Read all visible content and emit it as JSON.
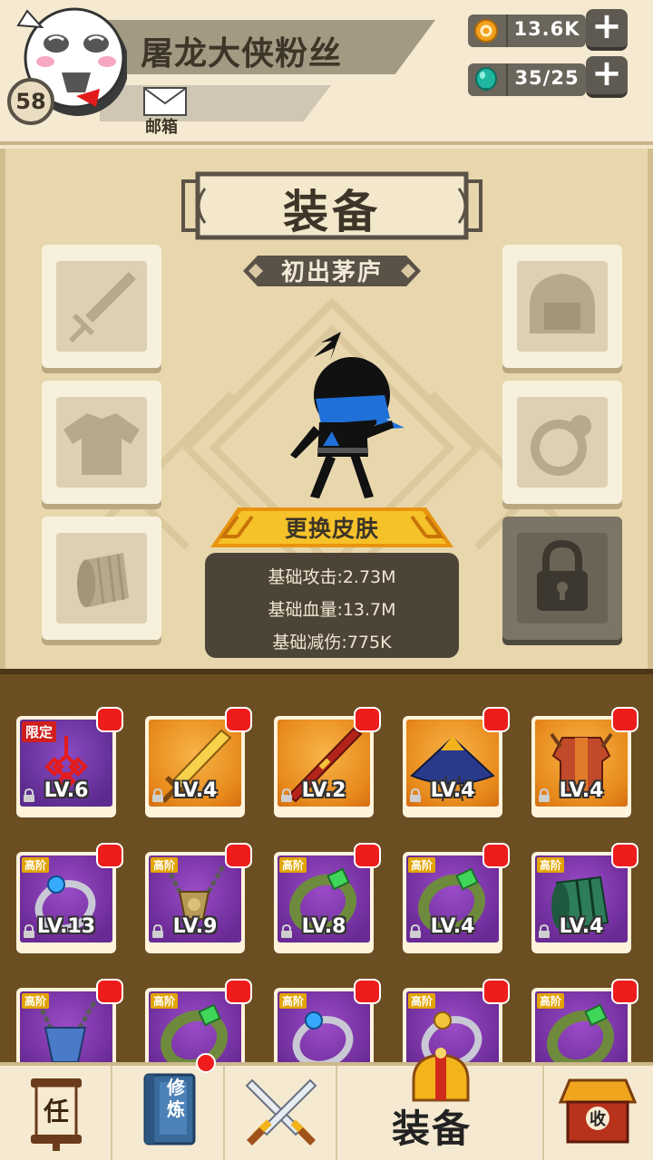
{
  "player": {
    "name": "屠龙大侠粉丝",
    "level": "58",
    "mail_label": "邮箱"
  },
  "currency": {
    "coins": "13.6K",
    "gems": "35/25",
    "coin_icon": "coin-icon",
    "gem_icon": "gem-icon"
  },
  "panel": {
    "title": "装备",
    "rank": "初出茅庐",
    "skin_button": "更换皮肤",
    "stats": {
      "attack": "基础攻击:2.73M",
      "hp": "基础血量:13.7M",
      "defense": "基础减伤:775K"
    },
    "slots": [
      "weapon-slot",
      "armor-slot",
      "bracer-slot",
      "helmet-slot",
      "ring-slot",
      "locked-slot"
    ]
  },
  "inventory": {
    "rows": [
      [
        {
          "level": "LV.6",
          "tag": "限定",
          "art": "chinese-knot-icon"
        },
        {
          "level": "LV.4",
          "tag": "",
          "art": "golden-sword-icon"
        },
        {
          "level": "LV.2",
          "tag": "",
          "art": "staff-icon"
        },
        {
          "level": "LV.4",
          "tag": "",
          "art": "straw-hat-icon"
        },
        {
          "level": "LV.4",
          "tag": "",
          "art": "armor-icon"
        }
      ],
      [
        {
          "level": "LV.13",
          "tag": "高阶",
          "art": "blue-gem-ring-icon"
        },
        {
          "level": "LV.9",
          "tag": "高阶",
          "art": "amulet-icon"
        },
        {
          "level": "LV.8",
          "tag": "高阶",
          "art": "jade-bracelet-icon"
        },
        {
          "level": "LV.4",
          "tag": "高阶",
          "art": "jade-bracelet-icon"
        },
        {
          "level": "LV.4",
          "tag": "高阶",
          "art": "jade-bracer-icon"
        }
      ],
      [
        {
          "level": "",
          "tag": "高阶",
          "art": "blue-pendant-icon"
        },
        {
          "level": "",
          "tag": "高阶",
          "art": "jade-bracelet-icon"
        },
        {
          "level": "",
          "tag": "高阶",
          "art": "blue-gem-ring-icon"
        },
        {
          "level": "",
          "tag": "高阶",
          "art": "gold-gem-ring-icon"
        },
        {
          "level": "",
          "tag": "高阶",
          "art": "jade-bracelet-icon"
        }
      ]
    ]
  },
  "nav": {
    "task": "任",
    "train": "修炼",
    "battle": "crossed-swords-icon",
    "equip": "装备",
    "shop": "收"
  },
  "colors": {
    "panel_bg": "#e8d7ad",
    "inventory_bg": "#6b4e22",
    "badge_red": "#ef1c1c",
    "skin_button_gold": "#f2b418"
  }
}
